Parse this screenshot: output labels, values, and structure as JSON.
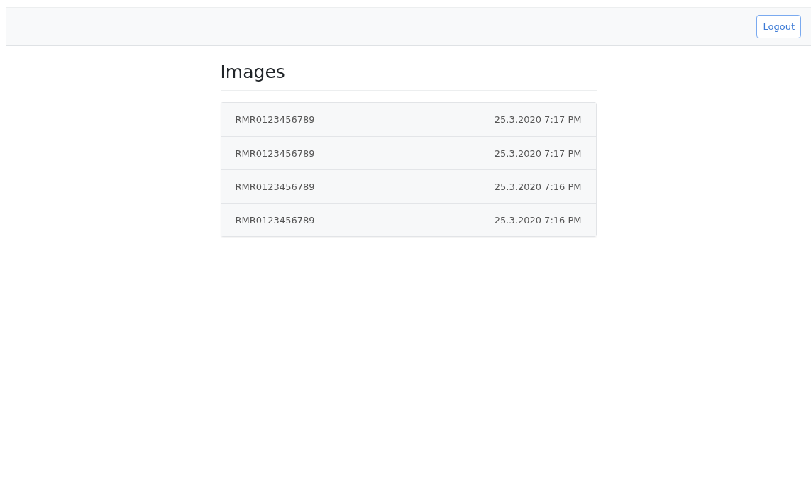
{
  "navbar": {
    "logout_button": "Logout"
  },
  "heading": "Images",
  "images": [
    {
      "name": "RMR0123456789",
      "date": "25.3.2020 7:17 PM"
    },
    {
      "name": "RMR0123456789",
      "date": "25.3.2020 7:17 PM"
    },
    {
      "name": "RMR0123456789",
      "date": "25.3.2020 7:16 PM"
    },
    {
      "name": "RMR0123456789",
      "date": "25.3.2020 7:16 PM"
    }
  ]
}
